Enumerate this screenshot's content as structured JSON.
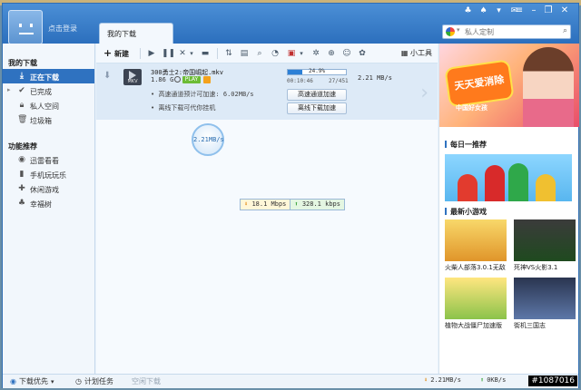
{
  "header": {
    "login_label": "点击登录",
    "tab_label": "我的下载",
    "search_placeholder": "私人定制",
    "tray_icons": [
      "bell-icon",
      "skin-icon",
      "shirt-icon",
      "mail-icon",
      "menu-icon"
    ],
    "window_buttons": [
      "minimize-icon",
      "restore-icon",
      "close-icon"
    ]
  },
  "sidebar": {
    "section1_title": "我的下载",
    "items": [
      {
        "label": "正在下载",
        "icon": "download-icon"
      },
      {
        "label": "已完成",
        "icon": "check-icon"
      },
      {
        "label": "私人空间",
        "icon": "lock-icon"
      },
      {
        "label": "垃圾箱",
        "icon": "trash-icon"
      }
    ],
    "section2_title": "功能推荐",
    "items2": [
      {
        "label": "迅雷看看",
        "icon": "video-icon"
      },
      {
        "label": "手机玩玩乐",
        "icon": "phone-icon"
      },
      {
        "label": "休闲游戏",
        "icon": "gamepad-icon"
      },
      {
        "label": "幸福树",
        "icon": "leaf-icon"
      }
    ]
  },
  "toolbar": {
    "new_label": "新建",
    "tools_label": "小工具"
  },
  "task": {
    "filename": "300勇士2:帝国崛起.mkv",
    "size": "1.86 G",
    "play_label": "PLAY",
    "progress_text": "24.9%",
    "progress": 0.249,
    "time": "00:10:46",
    "pieces": "27/451",
    "speed": "2.21  MB/s",
    "line1": "高速通道预计可加速: 6.02MB/s",
    "line2": "离线下载可代你挂机",
    "btn1": "高速通道加速",
    "btn2": "离线下载加速"
  },
  "bubble_speed": "2.21MB/s",
  "speed_box": {
    "down": "18.1 Mbps",
    "up": "328.1 kbps"
  },
  "right_panel": {
    "banner_text": "天天爱消除",
    "banner_sub": "中国好女孩",
    "daily_title": "每日一推荐",
    "new_games_title": "最新小游戏",
    "games": [
      {
        "label": "火柴人部落3.0.1无敌"
      },
      {
        "label": "死神VS火影3.1"
      },
      {
        "label": "植物大战僵尸加速版"
      },
      {
        "label": "街机三国志"
      }
    ]
  },
  "status": {
    "priority": "下载优先",
    "schedule": "计划任务",
    "empty": "空闲下载",
    "down_speed": "2.21MB/s",
    "up_speed": "0KB/s"
  },
  "watermark": "#1087016"
}
